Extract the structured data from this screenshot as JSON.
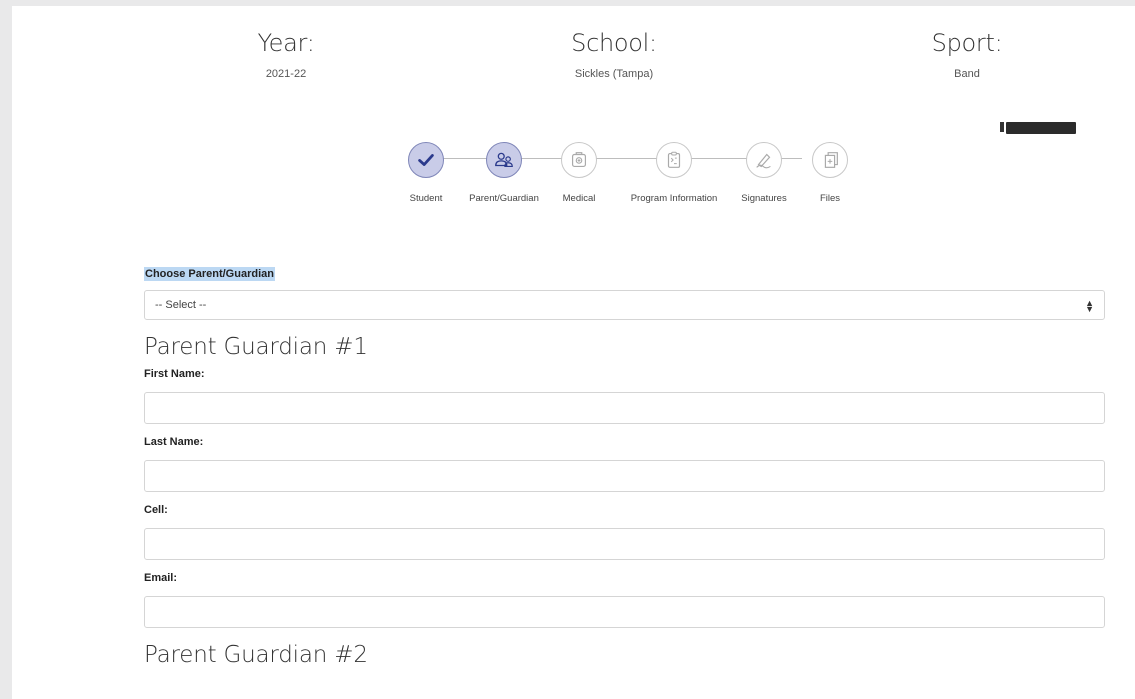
{
  "header": {
    "year_label": "Year:",
    "year_value": "2021-22",
    "school_label": "School:",
    "school_value": "Sickles (Tampa)",
    "sport_label": "Sport:",
    "sport_value": "Band"
  },
  "stepper": {
    "steps": [
      {
        "label": "Student",
        "icon": "check-icon",
        "state": "completed"
      },
      {
        "label": "Parent/Guardian",
        "icon": "parent-guardian-icon",
        "state": "active"
      },
      {
        "label": "Medical",
        "icon": "medical-kit-icon",
        "state": "pending"
      },
      {
        "label": "Program Information",
        "icon": "clipboard-icon",
        "state": "pending"
      },
      {
        "label": "Signatures",
        "icon": "signature-pen-icon",
        "state": "pending"
      },
      {
        "label": "Files",
        "icon": "files-icon",
        "state": "pending"
      }
    ]
  },
  "form": {
    "choose_label": "Choose Parent/Guardian",
    "choose_value": "-- Select --",
    "section1_title": "Parent Guardian #1",
    "first_name_label": "First Name:",
    "first_name_value": "",
    "last_name_label": "Last Name:",
    "last_name_value": "",
    "cell_label": "Cell:",
    "cell_value": "",
    "email_label": "Email:",
    "email_value": "",
    "section2_title": "Parent Guardian #2"
  },
  "colors": {
    "accent": "#2b3a8c",
    "completed_fill": "#c9cce8",
    "highlight": "#bcd8f3"
  }
}
